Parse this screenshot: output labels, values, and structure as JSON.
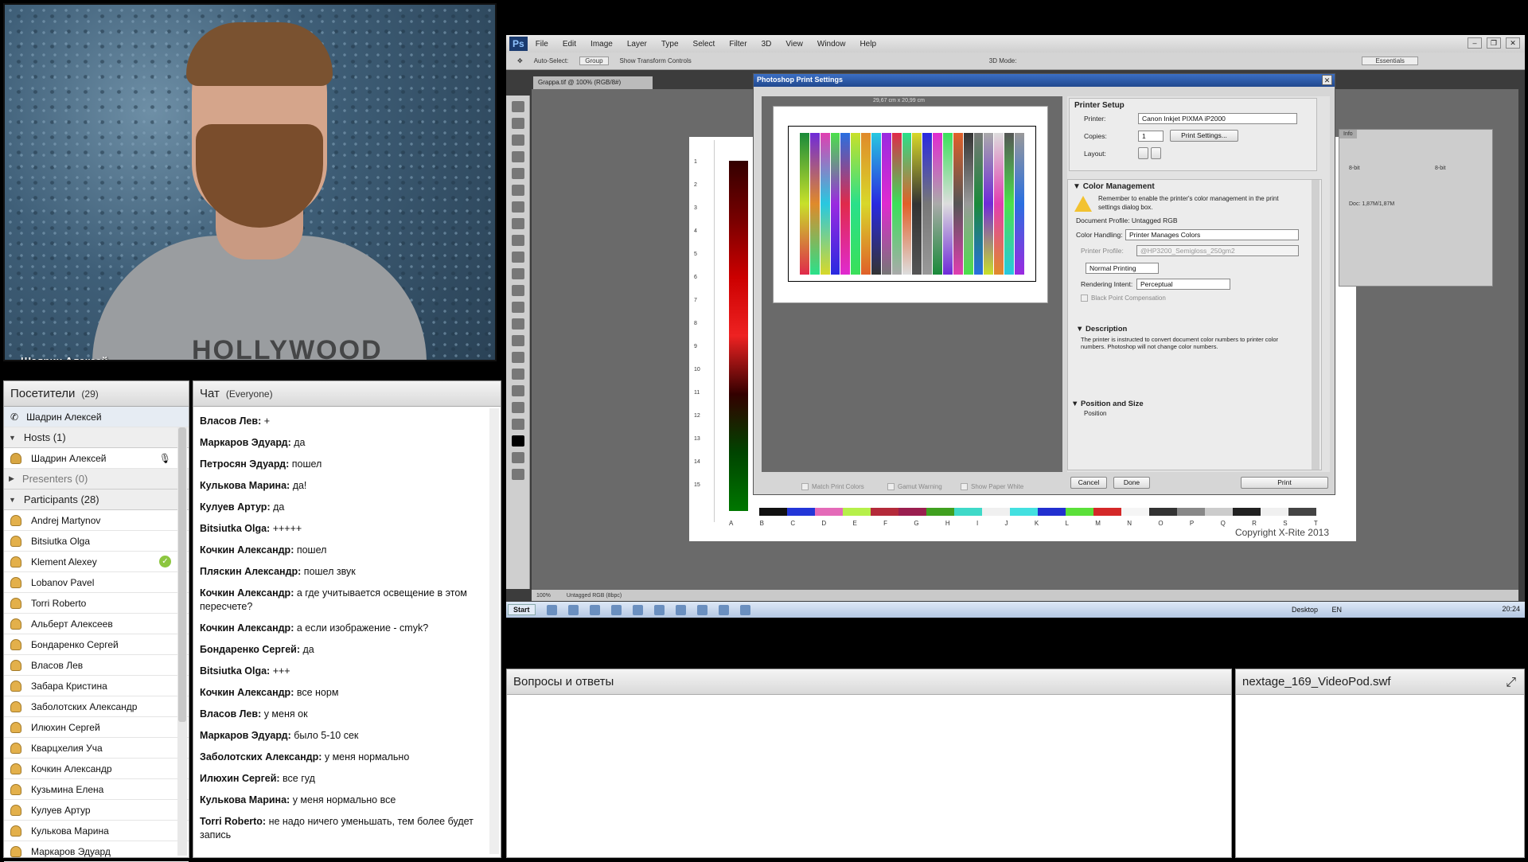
{
  "webcam": {
    "name": "Шадрин Алексей",
    "shirt_text": "HOLLYWOOD"
  },
  "attendees": {
    "title": "Посетители",
    "count": "(29)",
    "presenter": "Шадрин Алексей",
    "hosts_label": "Hosts (1)",
    "hosts": [
      "Шадрин Алексей"
    ],
    "presenters_label": "Presenters (0)",
    "participants_label": "Participants (28)",
    "participants": [
      "Andrej Martynov",
      "Bitsiutka Olga",
      "Klement Alexey",
      "Lobanov Pavel",
      "Torri Roberto",
      "Альберт Алексеев",
      "Бондаренко Сергей",
      "Власов Лев",
      "Забара Кристина",
      "Заболотских Александр",
      "Илюхин Сергей",
      "Кварцхелия Уча",
      "Кочкин Александр",
      "Кузьмина Елена",
      "Кулуев Артур",
      "Кулькова Марина",
      "Маркаров Эдуард"
    ]
  },
  "chat": {
    "title": "Чат",
    "audience": "(Everyone)",
    "messages": [
      {
        "author": "Власов Лев:",
        "text": " +"
      },
      {
        "author": "Маркаров Эдуард:",
        "text": " да"
      },
      {
        "author": "Петросян Эдуард:",
        "text": " пошел"
      },
      {
        "author": "Кулькова Марина:",
        "text": " да!"
      },
      {
        "author": "Кулуев Артур:",
        "text": " да"
      },
      {
        "author": "Bitsiutka Olga:",
        "text": " +++++"
      },
      {
        "author": "Кочкин Александр:",
        "text": " пошел"
      },
      {
        "author": "Пляскин Александр:",
        "text": " пошел звук"
      },
      {
        "author": "Кочкин Александр:",
        "text": " а где учитывается освещение в этом пересчете?"
      },
      {
        "author": "Кочкин Александр:",
        "text": " а если изображение - cmyk?"
      },
      {
        "author": "Бондаренко Сергей:",
        "text": " да"
      },
      {
        "author": "Bitsiutka Olga:",
        "text": " +++"
      },
      {
        "author": "Кочкин Александр:",
        "text": " все норм"
      },
      {
        "author": "Власов Лев:",
        "text": " у меня ок"
      },
      {
        "author": "Маркаров Эдуард:",
        "text": " было 5-10 сек"
      },
      {
        "author": "Заболотских Александр:",
        "text": " у меня нормально"
      },
      {
        "author": "Илюхин Сергей:",
        "text": " все гуд"
      },
      {
        "author": "Кулькова Марина:",
        "text": " у меня нормально все"
      },
      {
        "author": "Torri Roberto:",
        "text": " не надо ничего уменьшать, тем более будет запись"
      }
    ]
  },
  "photoshop": {
    "logo": "Ps",
    "menu": [
      "File",
      "Edit",
      "Image",
      "Layer",
      "Type",
      "Select",
      "Filter",
      "3D",
      "View",
      "Window",
      "Help"
    ],
    "options": [
      "Auto-Select:",
      "Group",
      "Show Transform Controls",
      "3D Mode:",
      "Essentials"
    ],
    "doc_tab": "Grappa.tif @ 100% (RGB/8#)",
    "zoom": "100%",
    "doc_profile": "Untagged RGB (8bpc)",
    "doc_copyright": "Copyright X-Rite 2013",
    "ruler_numbers": [
      "1",
      "2",
      "3",
      "4",
      "5",
      "6",
      "7",
      "8",
      "9",
      "10",
      "11",
      "12",
      "13",
      "14",
      "15"
    ],
    "patch_letters": [
      "A",
      "B",
      "C",
      "D",
      "E",
      "F",
      "G",
      "H",
      "I",
      "J",
      "K",
      "L",
      "M",
      "N",
      "O",
      "P",
      "Q",
      "R",
      "S",
      "T"
    ],
    "info_panel": {
      "tab": "Info",
      "doc": "Doc: 1,87M/1,87M",
      "bit1": "8-bit",
      "bit2": "8-bit"
    },
    "dialog": {
      "title": "Photoshop Print Settings",
      "preview_size": "29,67 cm x 20,99 cm",
      "printer_setup": "Printer Setup",
      "printer_label": "Printer:",
      "printer_value": "Canon Inkjet PIXMA iP2000",
      "copies_label": "Copies:",
      "copies_value": "1",
      "print_settings_btn": "Print Settings...",
      "layout_label": "Layout:",
      "color_mgmt": "Color Management",
      "cm_note": "Remember to enable the printer's color management in the print settings dialog box.",
      "doc_profile": "Document Profile: Untagged RGB",
      "color_handling_label": "Color Handling:",
      "color_handling_value": "Printer Manages Colors",
      "printer_profile_label": "Printer Profile:",
      "printer_profile_value": "@HP3200_Semigloss_250gm2",
      "normal_printing": "Normal Printing",
      "rendering_intent_label": "Rendering Intent:",
      "rendering_intent_value": "Perceptual",
      "black_point": "Black Point Compensation",
      "description": "Description",
      "description_text": "The printer is instructed to convert document color numbers to printer color numbers. Photoshop will not change color numbers.",
      "pos_size": "Position and Size",
      "position": "Position",
      "match_colors": "Match Print Colors",
      "gamut_warning": "Gamut Warning",
      "show_paper": "Show Paper White",
      "cancel": "Cancel",
      "done": "Done",
      "print": "Print"
    },
    "taskbar": {
      "start": "Start",
      "desktop": "Desktop",
      "lang": "EN",
      "clock": "20:24"
    }
  },
  "qa": {
    "title": "Вопросы и ответы"
  },
  "pod": {
    "title": "nextage_169_VideoPod.swf"
  },
  "colors": {
    "accent_blue": "#21488e",
    "panel_head": "#d9d9d9"
  }
}
